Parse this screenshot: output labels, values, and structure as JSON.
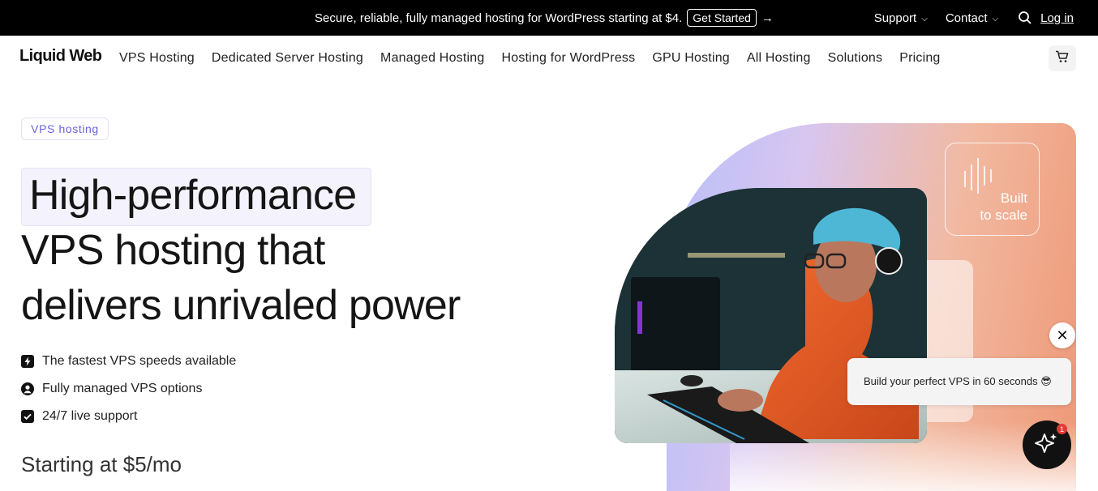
{
  "promo": {
    "text": "Secure, reliable, fully managed hosting for WordPress starting at $4.",
    "cta": "Get Started",
    "arrow": "→"
  },
  "utility": {
    "support": "Support",
    "contact": "Contact",
    "login": "Log in"
  },
  "brand": "Liquid Web",
  "nav": {
    "items": [
      "VPS Hosting",
      "Dedicated Server Hosting",
      "Managed Hosting",
      "Hosting for WordPress",
      "GPU Hosting",
      "All Hosting",
      "Solutions",
      "Pricing"
    ]
  },
  "hero": {
    "tag": "VPS hosting",
    "headline_1": "High-performance",
    "headline_2": "VPS hosting that",
    "headline_3": "delivers unrivaled power",
    "features": [
      "The fastest VPS speeds available",
      "Fully managed VPS options",
      "24/7 live support"
    ],
    "price": "Starting at $5/mo"
  },
  "visual": {
    "card_line1": "Built",
    "card_line2": "to scale"
  },
  "chat": {
    "bubble": "Build your perfect VPS in 60 seconds 😎",
    "badge": "1"
  },
  "colors": {
    "accent": "#6a63d6",
    "promo_bg": "#000000",
    "blob_left": "#b8bef8",
    "blob_right": "#ee9876"
  }
}
